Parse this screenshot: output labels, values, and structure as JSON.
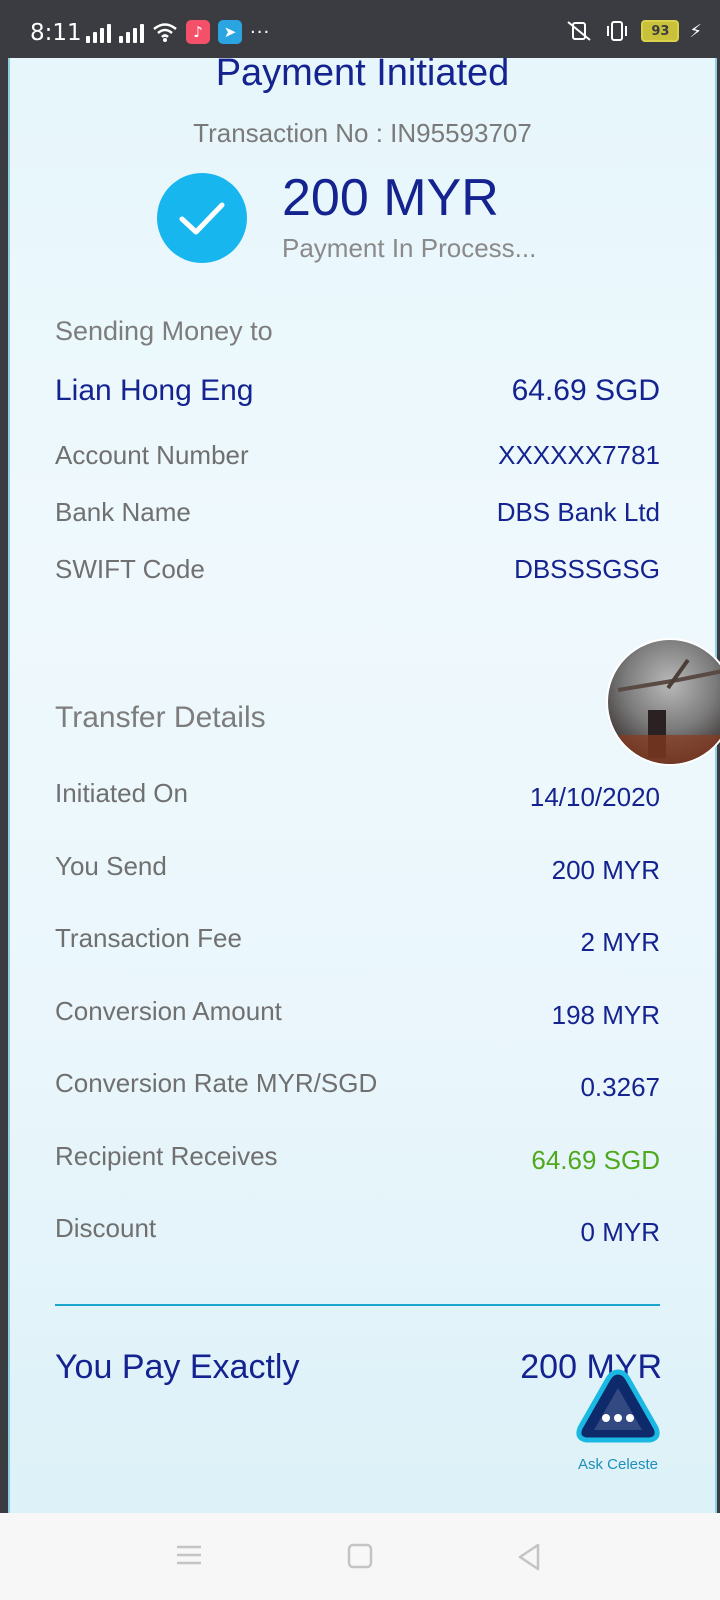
{
  "status_bar": {
    "time": "8:11",
    "battery": "93",
    "icons": [
      "signal-icon",
      "signal-icon",
      "wifi-icon",
      "music-app-icon",
      "telegram-app-icon",
      "more-dots-icon",
      "mute-vibrate-icon",
      "vibrate-icon",
      "battery-icon",
      "charging-icon"
    ]
  },
  "header": {
    "title": "Payment Initiated",
    "transaction_label": "Transaction No : IN95593707"
  },
  "summary": {
    "amount": "200 MYR",
    "status": "Payment In Process..."
  },
  "recipient": {
    "section_label": "Sending Money to",
    "name": "Lian Hong Eng",
    "name_amount": "64.69 SGD",
    "rows": [
      {
        "label": "Account Number",
        "value": "XXXXXX7781"
      },
      {
        "label": "Bank Name",
        "value": "DBS Bank Ltd"
      },
      {
        "label": "SWIFT Code",
        "value": "DBSSSGSG"
      }
    ]
  },
  "transfer": {
    "section_label": "Transfer Details",
    "rows": [
      {
        "label": "Initiated On",
        "value": "14/10/2020"
      },
      {
        "label": "You Send",
        "value": "200 MYR"
      },
      {
        "label": "Transaction Fee",
        "value": "2 MYR"
      },
      {
        "label": "Conversion Amount",
        "value": "198 MYR"
      },
      {
        "label": "Conversion Rate MYR/SGD",
        "value": "0.3267"
      },
      {
        "label": "Recipient Receives",
        "value": "64.69 SGD"
      },
      {
        "label": "Discount",
        "value": "0 MYR"
      }
    ]
  },
  "total": {
    "label": "You Pay Exactly",
    "value": "200 MYR"
  },
  "chat": {
    "label": "Ask Celeste"
  },
  "colors": {
    "primary": "#14238f",
    "accent": "#18b6ee",
    "success": "#4fa91e"
  }
}
